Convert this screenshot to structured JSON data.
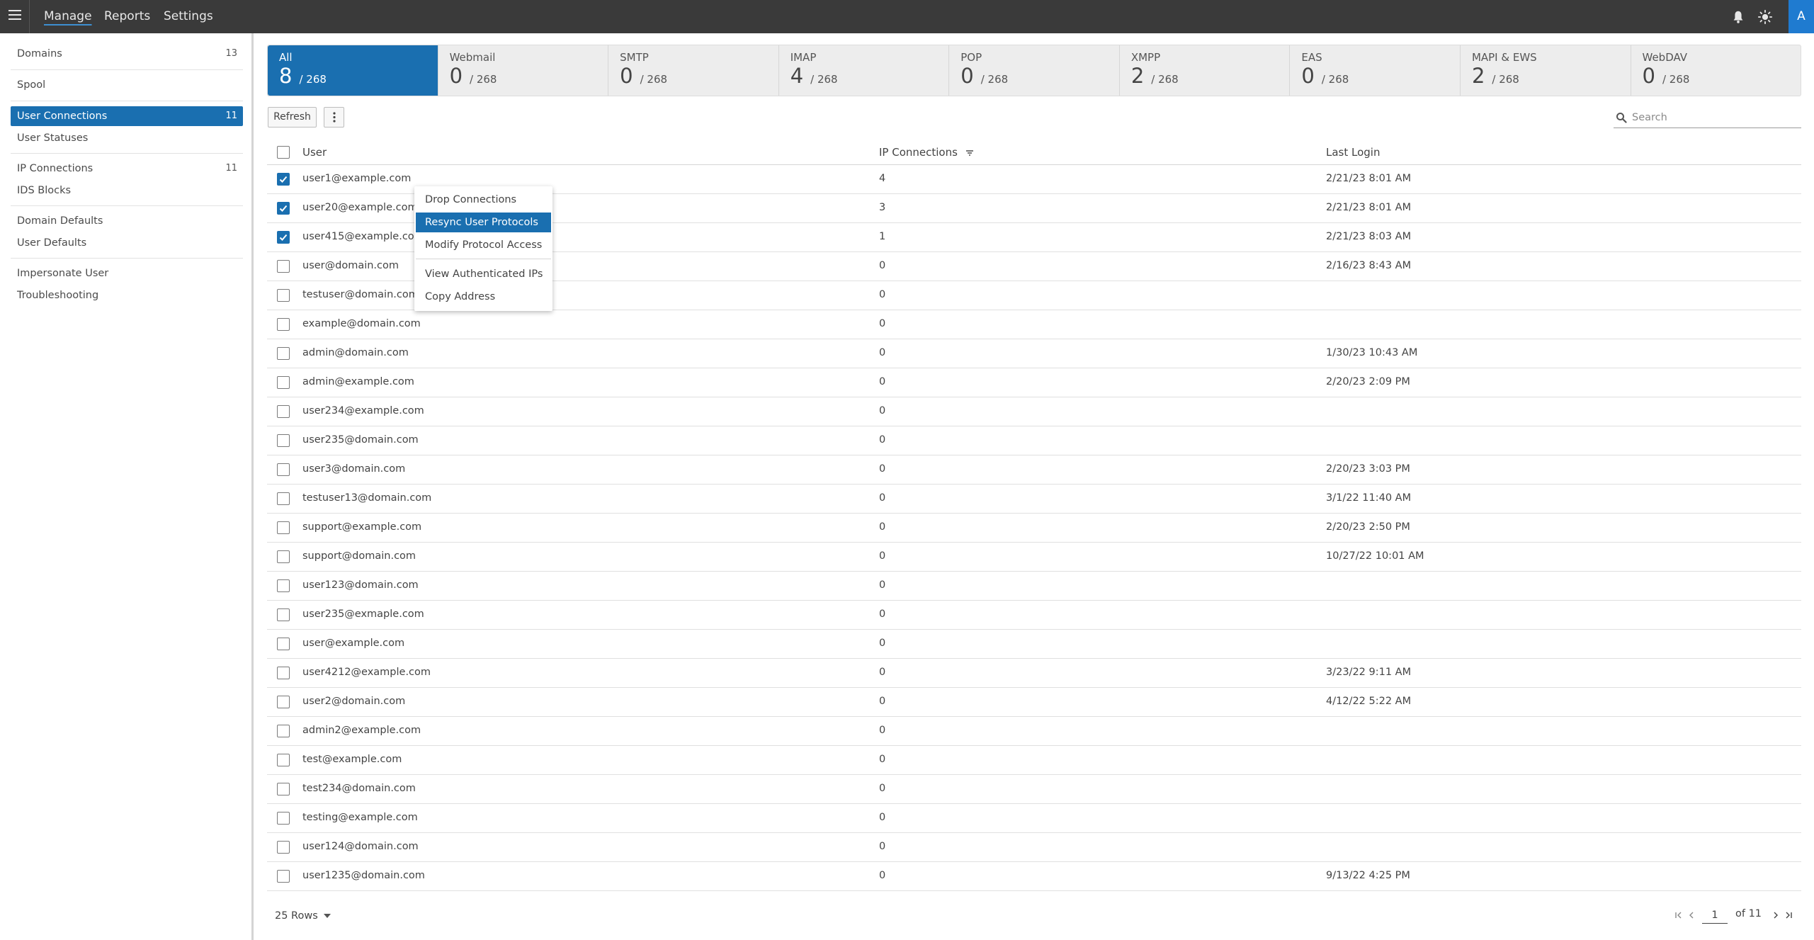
{
  "topbar": {
    "nav": [
      "Manage",
      "Reports",
      "Settings"
    ],
    "avatar_initial": "A",
    "icons": [
      "menu-icon",
      "bell-icon",
      "sun-icon"
    ]
  },
  "sidebar": {
    "items": [
      {
        "label": "Domains",
        "count": "13"
      },
      {
        "label": "Spool",
        "count": ""
      },
      {
        "label": "User Connections",
        "count": "11",
        "active": true
      },
      {
        "label": "User Statuses",
        "count": ""
      },
      {
        "label": "IP Connections",
        "count": "11"
      },
      {
        "label": "IDS Blocks",
        "count": ""
      },
      {
        "label": "Domain Defaults",
        "count": ""
      },
      {
        "label": "User Defaults",
        "count": ""
      },
      {
        "label": "Impersonate User",
        "count": ""
      },
      {
        "label": "Troubleshooting",
        "count": ""
      }
    ]
  },
  "protocol_tabs": [
    {
      "label": "All",
      "value": "8",
      "total": "/ 268",
      "active": true
    },
    {
      "label": "Webmail",
      "value": "0",
      "total": "/ 268"
    },
    {
      "label": "SMTP",
      "value": "0",
      "total": "/ 268"
    },
    {
      "label": "IMAP",
      "value": "4",
      "total": "/ 268"
    },
    {
      "label": "POP",
      "value": "0",
      "total": "/ 268"
    },
    {
      "label": "XMPP",
      "value": "2",
      "total": "/ 268"
    },
    {
      "label": "EAS",
      "value": "0",
      "total": "/ 268"
    },
    {
      "label": "MAPI & EWS",
      "value": "2",
      "total": "/ 268"
    },
    {
      "label": "WebDAV",
      "value": "0",
      "total": "/ 268"
    }
  ],
  "toolbar": {
    "refresh_label": "Refresh",
    "more_icon": "more-vertical-icon",
    "search_placeholder": "Search"
  },
  "table": {
    "columns": [
      "User",
      "IP Connections",
      "Last Login"
    ],
    "sorted_column": "IP Connections",
    "rows": [
      {
        "user": "user1@example.com",
        "ip": "4",
        "last": "2/21/23 8:01 AM",
        "checked": true
      },
      {
        "user": "user20@example.com",
        "ip": "3",
        "last": "2/21/23 8:01 AM",
        "checked": true
      },
      {
        "user": "user415@example.com",
        "ip": "1",
        "last": "2/21/23 8:03 AM",
        "checked": true
      },
      {
        "user": "user@domain.com",
        "ip": "0",
        "last": "2/16/23 8:43 AM",
        "checked": false
      },
      {
        "user": "testuser@domain.com",
        "ip": "0",
        "last": "",
        "checked": false
      },
      {
        "user": "example@domain.com",
        "ip": "0",
        "last": "",
        "checked": false
      },
      {
        "user": "admin@domain.com",
        "ip": "0",
        "last": "1/30/23 10:43 AM",
        "checked": false
      },
      {
        "user": "admin@example.com",
        "ip": "0",
        "last": "2/20/23 2:09 PM",
        "checked": false
      },
      {
        "user": "user234@example.com",
        "ip": "0",
        "last": "",
        "checked": false
      },
      {
        "user": "user235@domain.com",
        "ip": "0",
        "last": "",
        "checked": false
      },
      {
        "user": "user3@domain.com",
        "ip": "0",
        "last": "2/20/23 3:03 PM",
        "checked": false
      },
      {
        "user": "testuser13@domain.com",
        "ip": "0",
        "last": "3/1/22 11:40 AM",
        "checked": false
      },
      {
        "user": "support@example.com",
        "ip": "0",
        "last": "2/20/23 2:50 PM",
        "checked": false
      },
      {
        "user": "support@domain.com",
        "ip": "0",
        "last": "10/27/22 10:01 AM",
        "checked": false
      },
      {
        "user": "user123@domain.com",
        "ip": "0",
        "last": "",
        "checked": false
      },
      {
        "user": "user235@exmaple.com",
        "ip": "0",
        "last": "",
        "checked": false
      },
      {
        "user": "user@example.com",
        "ip": "0",
        "last": "",
        "checked": false
      },
      {
        "user": "user4212@example.com",
        "ip": "0",
        "last": "3/23/22 9:11 AM",
        "checked": false
      },
      {
        "user": "user2@domain.com",
        "ip": "0",
        "last": "4/12/22 5:22 AM",
        "checked": false
      },
      {
        "user": "admin2@example.com",
        "ip": "0",
        "last": "",
        "checked": false
      },
      {
        "user": "test@example.com",
        "ip": "0",
        "last": "",
        "checked": false
      },
      {
        "user": "test234@domain.com",
        "ip": "0",
        "last": "",
        "checked": false
      },
      {
        "user": "testing@example.com",
        "ip": "0",
        "last": "",
        "checked": false
      },
      {
        "user": "user124@domain.com",
        "ip": "0",
        "last": "",
        "checked": false
      },
      {
        "user": "user1235@domain.com",
        "ip": "0",
        "last": "9/13/22 4:25 PM",
        "checked": false
      }
    ]
  },
  "context_menu": {
    "items": [
      "Drop Connections",
      "Resync User Protocols",
      "Modify Protocol Access",
      "View Authenticated IPs",
      "Copy Address"
    ],
    "highlighted": "Resync User Protocols"
  },
  "footer": {
    "rows_label": "25 Rows",
    "page": "1",
    "of_label": "of 11"
  },
  "colors": {
    "accent": "#1a6fb0",
    "topbar": "#3a3a3a",
    "avatar": "#1f7bd0"
  }
}
